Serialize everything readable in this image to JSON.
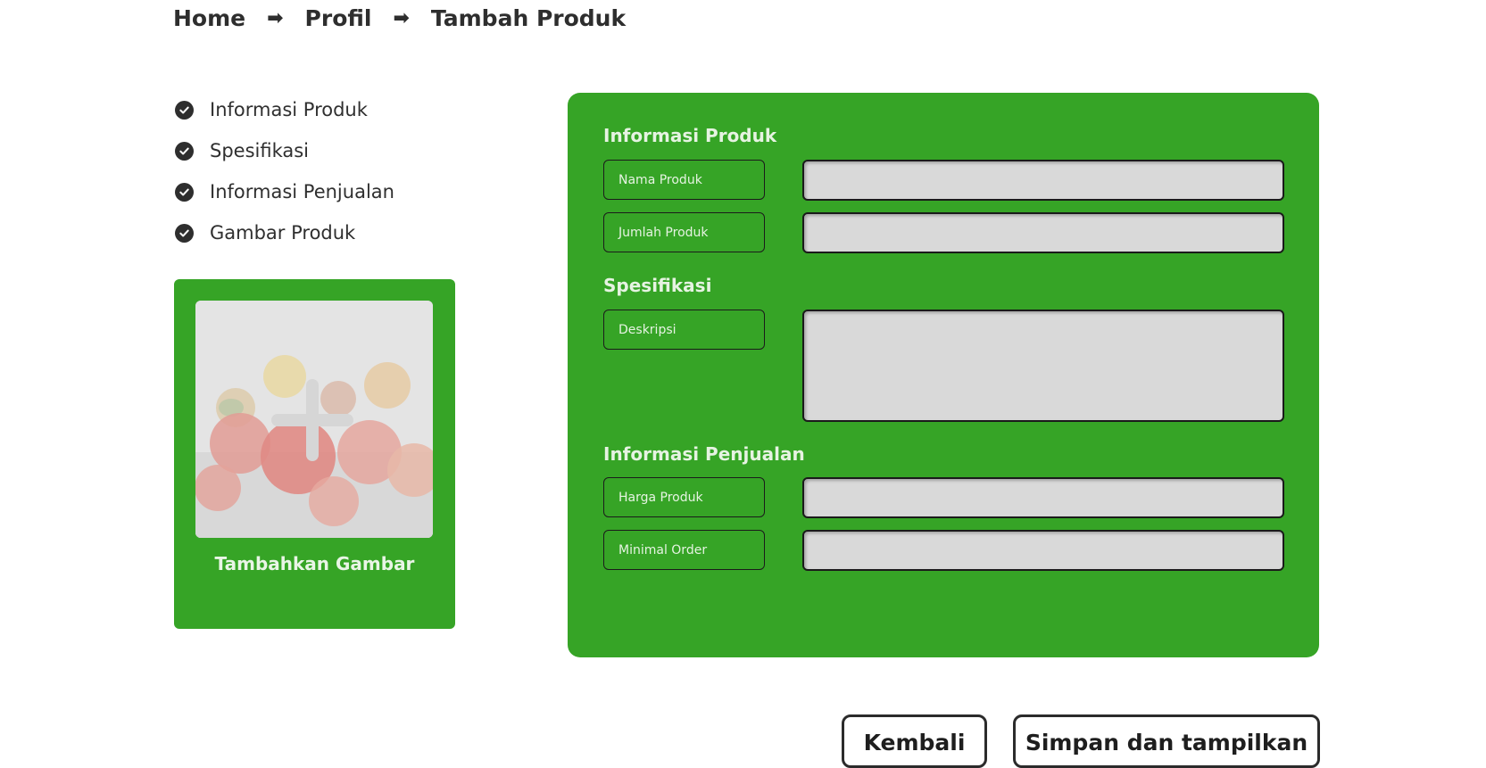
{
  "breadcrumb": {
    "home": "Home",
    "profil": "Profil",
    "current": "Tambah Produk",
    "separator": "➡"
  },
  "steps": [
    "Informasi Produk",
    "Spesifikasi",
    "Informasi Penjualan",
    "Gambar Produk"
  ],
  "image_upload": {
    "label": "Tambahkan Gambar"
  },
  "form": {
    "section_info": "Informasi Produk",
    "nama_produk": "Nama Produk",
    "jumlah_produk": "Jumlah Produk",
    "section_spec": "Spesifikasi",
    "deskripsi": "Deskripsi",
    "section_sales": "Informasi Penjualan",
    "harga_produk": "Harga Produk",
    "minimal_order": "Minimal Order"
  },
  "buttons": {
    "back": "Kembali",
    "save": "Simpan dan tampilkan"
  },
  "colors": {
    "accent_green": "#36a426",
    "input_bg": "#d9d9d9",
    "text_dark": "#2e2e2e"
  }
}
